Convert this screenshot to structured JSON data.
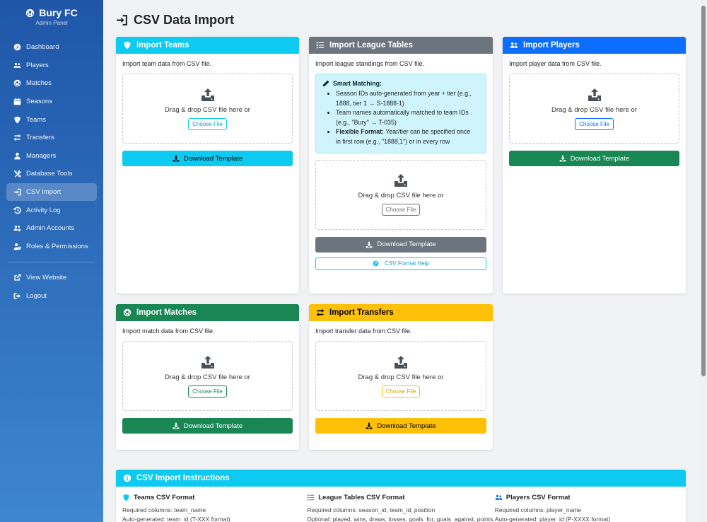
{
  "brand": {
    "title": "Bury FC",
    "subtitle": "Admin Panel"
  },
  "nav": [
    {
      "label": "Dashboard",
      "icon": "dashboard-icon"
    },
    {
      "label": "Players",
      "icon": "users-icon"
    },
    {
      "label": "Matches",
      "icon": "football-icon"
    },
    {
      "label": "Seasons",
      "icon": "calendar-icon"
    },
    {
      "label": "Teams",
      "icon": "shield-icon"
    },
    {
      "label": "Transfers",
      "icon": "exchange-icon"
    },
    {
      "label": "Managers",
      "icon": "user-icon"
    },
    {
      "label": "Database Tools",
      "icon": "tools-icon"
    },
    {
      "label": "CSV Import",
      "icon": "import-icon",
      "active": true
    },
    {
      "label": "Activity Log",
      "icon": "history-icon"
    },
    {
      "label": "Admin Accounts",
      "icon": "users-cog-icon"
    },
    {
      "label": "Roles & Permissions",
      "icon": "user-shield-icon"
    }
  ],
  "nav_bottom": [
    {
      "label": "View Website",
      "icon": "external-link-icon"
    },
    {
      "label": "Logout",
      "icon": "logout-icon"
    }
  ],
  "page": {
    "title": "CSV Data Import"
  },
  "common": {
    "dropzone_text": "Drag & drop CSV file here or",
    "choose_file": "Choose File",
    "download_template": "Download Template"
  },
  "cards": {
    "teams": {
      "title": "Import Teams",
      "desc": "Import team data from CSV file.",
      "color": "#0dcaf0"
    },
    "league": {
      "title": "Import League Tables",
      "desc": "Import league standings from CSV file.",
      "color": "#6c757d",
      "smart_title": "Smart Matching:",
      "smart_items": [
        {
          "bold": "",
          "lines": [
            "Season IDs auto-generated from year + tier (e.g.,",
            "1888, tier 1 → S-1888-1)"
          ]
        },
        {
          "bold": "",
          "lines": [
            "Team names automatically matched to team IDs",
            "(e.g., \"Bury\" → T-035)"
          ]
        },
        {
          "bold": "Flexible Format:",
          "lines": [
            " Year/tier can be specified once",
            "in first row (e.g., \"1888,1\") or in every row"
          ]
        }
      ],
      "help": "CSV Format Help"
    },
    "players": {
      "title": "Import Players",
      "desc": "Import player data from CSV file.",
      "color": "#0d6efd"
    },
    "matches": {
      "title": "Import Matches",
      "desc": "Import match data from CSV file.",
      "color": "#198754"
    },
    "transfers": {
      "title": "Import Transfers",
      "desc": "Import transfer data from CSV file.",
      "color": "#ffc107"
    }
  },
  "instructions": {
    "title": "CSV Import Instructions",
    "color": "#0dcaf0",
    "columns": [
      {
        "title": "Teams CSV Format",
        "icon": "shield-icon",
        "lines": [
          "Required columns: team_name",
          "Auto-generated: team_id (T-XXX format)"
        ]
      },
      {
        "title": "League Tables CSV Format",
        "icon": "list-icon",
        "lines": [
          "Required columns: season_id, team_id, position",
          "Optional: played, wins, draws, losses, goals_for, goals_against, points,"
        ]
      },
      {
        "title": "Players CSV Format",
        "icon": "users-icon",
        "lines": [
          "Required columns: player_name",
          "Auto-generated: player_id (P-XXXX format)"
        ]
      }
    ]
  }
}
